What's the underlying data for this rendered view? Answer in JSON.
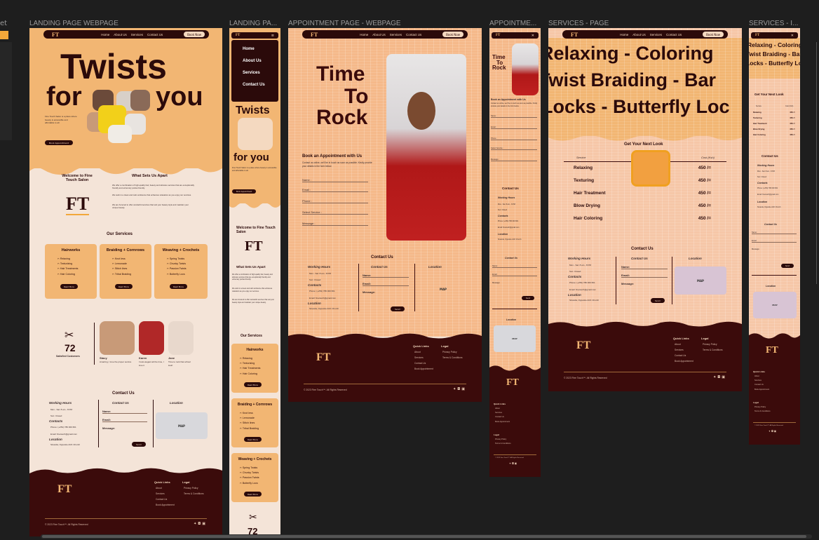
{
  "frames": {
    "landing": {
      "label": "LANDING PAGE WEBPAGE"
    },
    "landing_mobile": {
      "label": "LANDING PA..."
    },
    "appointment": {
      "label": "APPOINTMENT PAGE - WEBPAGE"
    },
    "appointment_mobile": {
      "label": "APPOINTME..."
    },
    "services": {
      "label": "SERVICES - PAGE"
    },
    "services_mobile": {
      "label": "SERVICES - I..."
    }
  },
  "left_stub": {
    "label": "et"
  },
  "nav": {
    "logo": "FT",
    "links": [
      "Home",
      "About Us",
      "Services",
      "Contact Us"
    ],
    "book": "Book Now"
  },
  "mobile_menu": [
    "Home",
    "About Us",
    "Services",
    "Contact Us"
  ],
  "landing": {
    "hero_line1": "Twists",
    "hero_for": "for",
    "hero_you": "you",
    "hero_desc": "Fine Touch Salon is a place where beauty is accessible and affordable to all.",
    "book_btn": "Book Appointment",
    "welcome": "Welcome to Fine Touch Salon",
    "sets_apart": "What Sets Us Apart",
    "apart_p1": "We offer a combination of high-quality hair, beauty and skincare services that are exceptionally friendly and extremely pocket-friendly.",
    "apart_p2": "We work in a clean and calm ambience that enhances relaxation as you enjoy our services.",
    "apart_p3": "We are honored to offer wonderful services that suit your beauty style and maintain your unique beauty.",
    "our_services": "Our Services",
    "cards": [
      {
        "title": "Hairworks",
        "items": [
          "Relaxing",
          "Texturizing",
          "Hair Treatments",
          "Hair Coloring"
        ]
      },
      {
        "title": "Braiding + Cornrows",
        "items": [
          "Knot less",
          "Lemonade",
          "Stitch lines",
          "Tribal Braiding"
        ]
      },
      {
        "title": "Weaving + Crochets",
        "items": [
          "Spring Twists",
          "Chunky Twists",
          "Passion Twists",
          "Butterfly Locs"
        ]
      }
    ],
    "read_more": "Read More",
    "satisfied_count": "72",
    "satisfied_label": "Satisfied Customers",
    "testimonials": [
      {
        "name": "Stacy",
        "text": "Amazing, I love the proper service"
      },
      {
        "name": "Karen",
        "text": "I look elegant all the time, I love it"
      },
      {
        "name": "Jane",
        "text": "Time to rock that school look!"
      }
    ]
  },
  "contact": {
    "title": "Contact Us",
    "working_hours": "Working Hours",
    "hours": [
      "Mon - Sat: 8 am - 8 PM",
      "Sun: Closed"
    ],
    "contacts_h": "Contacts",
    "phone": "Phone: (+254) 786 000 661",
    "email": "Email: finetouch@gmail.com",
    "location_h": "Location",
    "location": "Sinanda, Opposite ACK Church",
    "form_title": "Contact Us",
    "fields": [
      "Name:",
      "Email:",
      "Message:"
    ],
    "send": "Send",
    "location_title": "Location",
    "map": "MAP"
  },
  "appointment": {
    "hero_line1": "Time",
    "hero_line2": "To",
    "hero_line3": "Rock",
    "form_title": "Book an Appointment with Us",
    "form_desc": "Contact us online, we'll be in touch as soon as possible. Kindly provide your details in the form below.",
    "fields": [
      "Name :",
      "Email :",
      "Phone :",
      "Select Service :",
      "Message :"
    ]
  },
  "services": {
    "marquee": [
      "Relaxing - Coloring",
      "Twist Braiding - Bar",
      "Locks - Butterfly Loc"
    ],
    "marquee_mobile": [
      "Relaxing - Coloring",
      "Twist Braiding - Bar",
      "Locks - Butterfly Loc"
    ],
    "look_title": "Get Your Next Look",
    "col_service": "Service",
    "col_cost": "Cost (Ksh)",
    "prices": [
      {
        "service": "Relaxing",
        "price": "450 /="
      },
      {
        "service": "Texturing",
        "price": "450 /="
      },
      {
        "service": "Hair Treatment",
        "price": "450 /="
      },
      {
        "service": "Blow Drying",
        "price": "450 /="
      },
      {
        "service": "Hair Coloring",
        "price": "450 /="
      }
    ]
  },
  "footer": {
    "logo": "FT",
    "quick_links": "Quick Links",
    "quick": [
      "About",
      "Services",
      "Contact Us",
      "Book Appointment"
    ],
    "legal": "Legal",
    "legal_items": [
      "Privacy Policy",
      "Terms & Conditions"
    ],
    "copyright": "© 2023 Fine Touch™. All Rights Reserved"
  },
  "colors": {
    "orange": "#f2b673",
    "maroon": "#2b0a0a",
    "cream": "#f4e4d8",
    "footer": "#3b0b0b",
    "canvas": "#1e1e1e"
  }
}
